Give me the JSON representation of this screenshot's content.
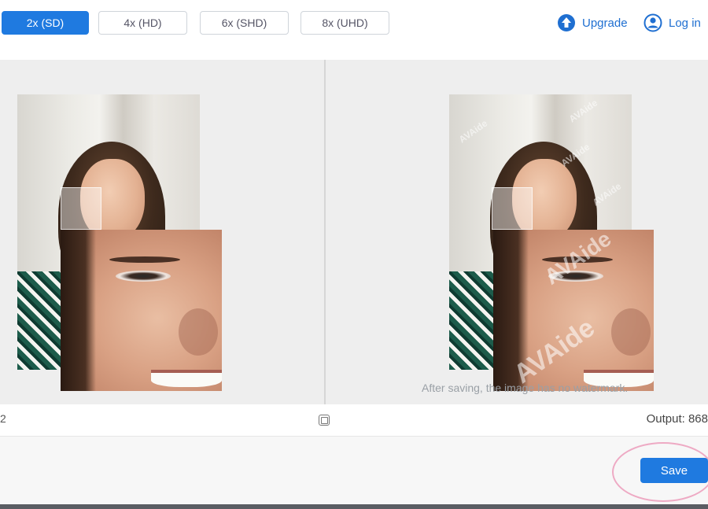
{
  "toolbar": {
    "scales": [
      {
        "label": "2x (SD)",
        "active": true
      },
      {
        "label": "4x (HD)",
        "active": false
      },
      {
        "label": "6x (SHD)",
        "active": false
      },
      {
        "label": "8x (UHD)",
        "active": false
      }
    ],
    "upgrade_label": "Upgrade",
    "login_label": "Log in"
  },
  "preview": {
    "watermark_text": "AVAide",
    "note": "After saving, the image has no watermark."
  },
  "status": {
    "left_value": "2",
    "output_label": "Output: 868"
  },
  "footer": {
    "save_label": "Save"
  },
  "colors": {
    "accent": "#1f7ae0",
    "highlight": "#eeaac4"
  }
}
